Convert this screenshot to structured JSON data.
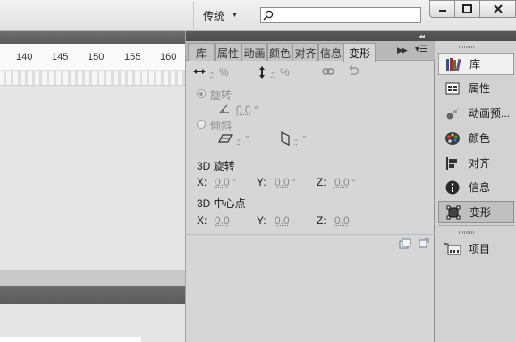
{
  "toolbar": {
    "workspace_label": "传统",
    "search_placeholder": ""
  },
  "window_controls": {
    "minimize": "—",
    "maximize": "□",
    "close": "✕"
  },
  "timeline": {
    "ruler_numbers": [
      "140",
      "145",
      "150",
      "155",
      "160"
    ]
  },
  "panel": {
    "tabs": [
      "库",
      "属性",
      "动画",
      "颜色",
      "对齐",
      "信息",
      "变形"
    ],
    "active_tab": "变形",
    "scale": {
      "width_value": "-",
      "width_unit": "%",
      "height_value": "-",
      "height_unit": "%"
    },
    "rotate_label": "旋转",
    "rotate_value": "0.0",
    "skew_label": "倾斜",
    "skew_h_value": "-",
    "skew_v_value": "-",
    "degree": "°",
    "rotation3d": {
      "title": "3D 旋转",
      "x_label": "X:",
      "x_value": "0.0",
      "y_label": "Y:",
      "y_value": "0.0",
      "z_label": "Z:",
      "z_value": "0.0"
    },
    "center3d": {
      "title": "3D 中心点",
      "x_label": "X:",
      "x_value": "0.0",
      "y_label": "Y:",
      "y_value": "0.0",
      "z_label": "Z:",
      "z_value": "0.0"
    }
  },
  "dock": {
    "items": [
      {
        "label": "库",
        "icon": "library-icon"
      },
      {
        "label": "属性",
        "icon": "properties-icon"
      },
      {
        "label": "动画预...",
        "icon": "motion-presets-icon"
      },
      {
        "label": "颜色",
        "icon": "color-icon"
      },
      {
        "label": "对齐",
        "icon": "align-icon"
      },
      {
        "label": "信息",
        "icon": "info-icon"
      },
      {
        "label": "变形",
        "icon": "transform-icon"
      },
      {
        "label": "项目",
        "icon": "project-icon"
      }
    ]
  }
}
